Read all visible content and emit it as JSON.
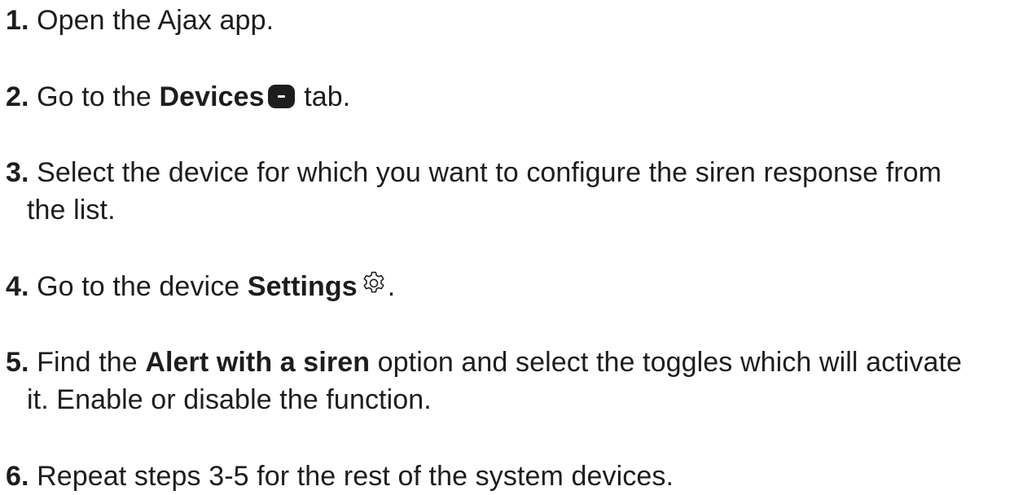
{
  "steps": [
    {
      "num": "1.",
      "text": "Open the Ajax app."
    },
    {
      "num": "2.",
      "pre": "Go to the ",
      "bold": "Devices",
      "post": " tab.",
      "icon": "devices-icon"
    },
    {
      "num": "3.",
      "text": "Select the device for which you want to configure the siren response from",
      "cont": "the list."
    },
    {
      "num": "4.",
      "pre": "Go to the device ",
      "bold": "Settings",
      "post": ".",
      "icon": "gear-icon"
    },
    {
      "num": "5.",
      "pre": "Find the ",
      "bold": "Alert with a siren",
      "post": " option and select the toggles which will activate",
      "cont": "it. Enable or disable the function."
    },
    {
      "num": "6.",
      "text": "Repeat steps 3-5 for the rest of the system devices."
    }
  ],
  "colors": {
    "text": "#1d1d1f",
    "icon": "#1d1d1f"
  }
}
